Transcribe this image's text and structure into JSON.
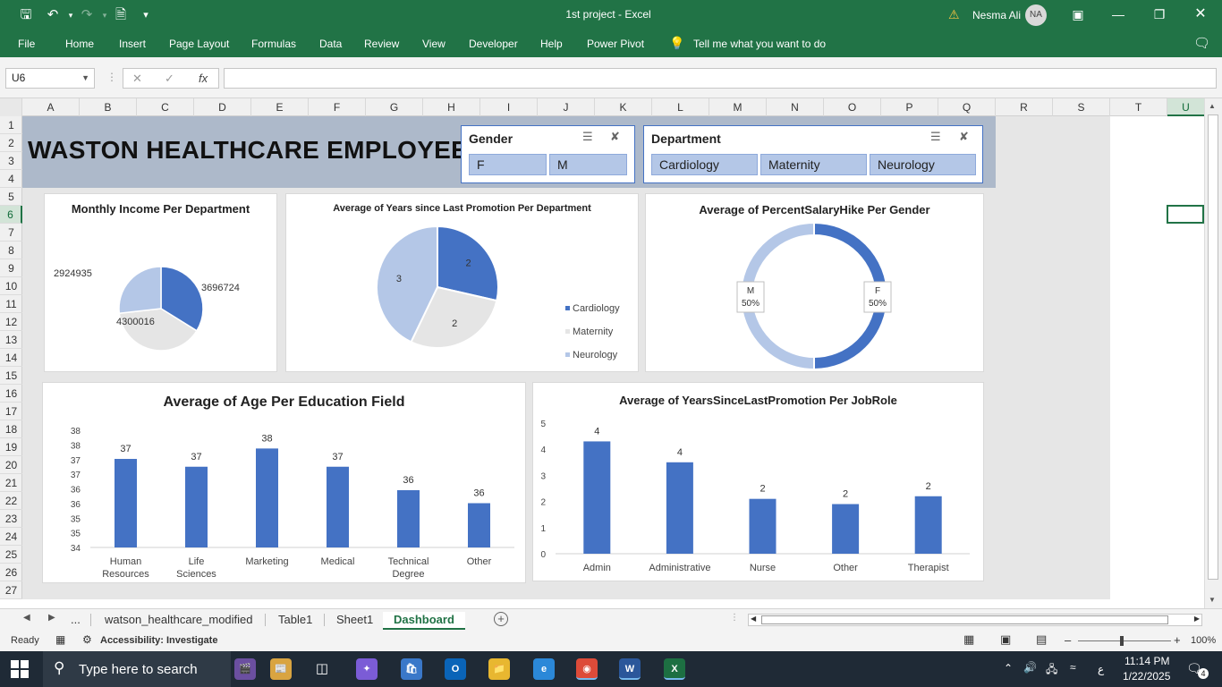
{
  "window": {
    "title": "1st project  -  Excel",
    "user_name": "Nesma Ali",
    "user_initials": "NA"
  },
  "ribbon": {
    "tabs": [
      "File",
      "Home",
      "Insert",
      "Page Layout",
      "Formulas",
      "Data",
      "Review",
      "View",
      "Developer",
      "Help",
      "Power Pivot"
    ],
    "tell_me": "Tell me what you want to do"
  },
  "formula_bar": {
    "name_box": "U6",
    "formula": "",
    "fx": "fx"
  },
  "grid": {
    "columns": [
      "A",
      "B",
      "C",
      "D",
      "E",
      "F",
      "G",
      "H",
      "I",
      "J",
      "K",
      "L",
      "M",
      "N",
      "O",
      "P",
      "Q",
      "R",
      "S",
      "T",
      "U"
    ],
    "rows": [
      "1",
      "2",
      "3",
      "4",
      "5",
      "6",
      "7",
      "8",
      "9",
      "10",
      "11",
      "12",
      "13",
      "14",
      "15",
      "16",
      "17",
      "18",
      "19",
      "20",
      "21",
      "22",
      "23",
      "24",
      "25",
      "26",
      "27"
    ],
    "active_column": "U",
    "active_row": "6"
  },
  "dashboard": {
    "title": "WASTON HEALTHCARE EMPLOYEES",
    "slicers": [
      {
        "header": "Gender",
        "items": [
          "F",
          "M"
        ]
      },
      {
        "header": "Department",
        "items": [
          "Cardiology",
          "Maternity",
          "Neurology"
        ]
      }
    ]
  },
  "charts": {
    "accent": "#4472c4",
    "light_gray": "#e5e5e5",
    "light_blue": "#b4c7e7"
  },
  "chart_data": [
    {
      "type": "pie",
      "title": "Monthly Income Per Department",
      "categories": [
        "Cardiology",
        "Maternity",
        "Neurology"
      ],
      "values": [
        3696724,
        4300016,
        2924935
      ]
    },
    {
      "type": "pie",
      "title": "Average of Years since Last Promotion Per Department",
      "categories": [
        "Cardiology",
        "Maternity",
        "Neurology"
      ],
      "values": [
        2,
        2,
        3
      ],
      "legend": [
        "Cardiology",
        "Maternity",
        "Neurology"
      ],
      "legend_position": "right"
    },
    {
      "type": "pie",
      "subtype": "doughnut",
      "title": "Average of PercentSalaryHike Per Gender",
      "categories": [
        "F",
        "M"
      ],
      "values": [
        50,
        50
      ],
      "labels": [
        "F\n50%",
        "M\n50%"
      ]
    },
    {
      "type": "bar",
      "title": "Average of Age Per Education Field",
      "categories": [
        "Human Resources",
        "Life Sciences",
        "Marketing",
        "Medical",
        "Technical Degree",
        "Other"
      ],
      "values": [
        37.4,
        37.1,
        37.8,
        37.1,
        36.2,
        35.7
      ],
      "data_labels": [
        "37",
        "37",
        "38",
        "37",
        "36",
        "36"
      ],
      "ytick_labels": [
        "34",
        "35",
        "35",
        "36",
        "36",
        "37",
        "37",
        "38",
        "38"
      ],
      "ylim": [
        34,
        38.5
      ]
    },
    {
      "type": "bar",
      "title": "Average of YearsSinceLastPromotion Per JobRole",
      "categories": [
        "Admin",
        "Administrative",
        "Nurse",
        "Other",
        "Therapist"
      ],
      "values": [
        4.3,
        3.5,
        2.1,
        1.9,
        2.2
      ],
      "data_labels": [
        "4",
        "4",
        "2",
        "2",
        "2"
      ],
      "ytick_labels": [
        "0",
        "1",
        "2",
        "3",
        "4",
        "5"
      ],
      "ylim": [
        0,
        5
      ]
    }
  ],
  "sheet_tabs": {
    "ellipsis": "...",
    "tabs": [
      "watson_healthcare_modified",
      "Table1",
      "Sheet1",
      "Dashboard"
    ],
    "active": "Dashboard",
    "add": "+"
  },
  "status_bar": {
    "ready": "Ready",
    "accessibility": "Accessibility: Investigate",
    "zoom": "100%"
  },
  "taskbar": {
    "search_placeholder": "Type here to search",
    "time": "11:14 PM",
    "date": "1/22/2025",
    "lang": "ع",
    "notifications": "4"
  }
}
